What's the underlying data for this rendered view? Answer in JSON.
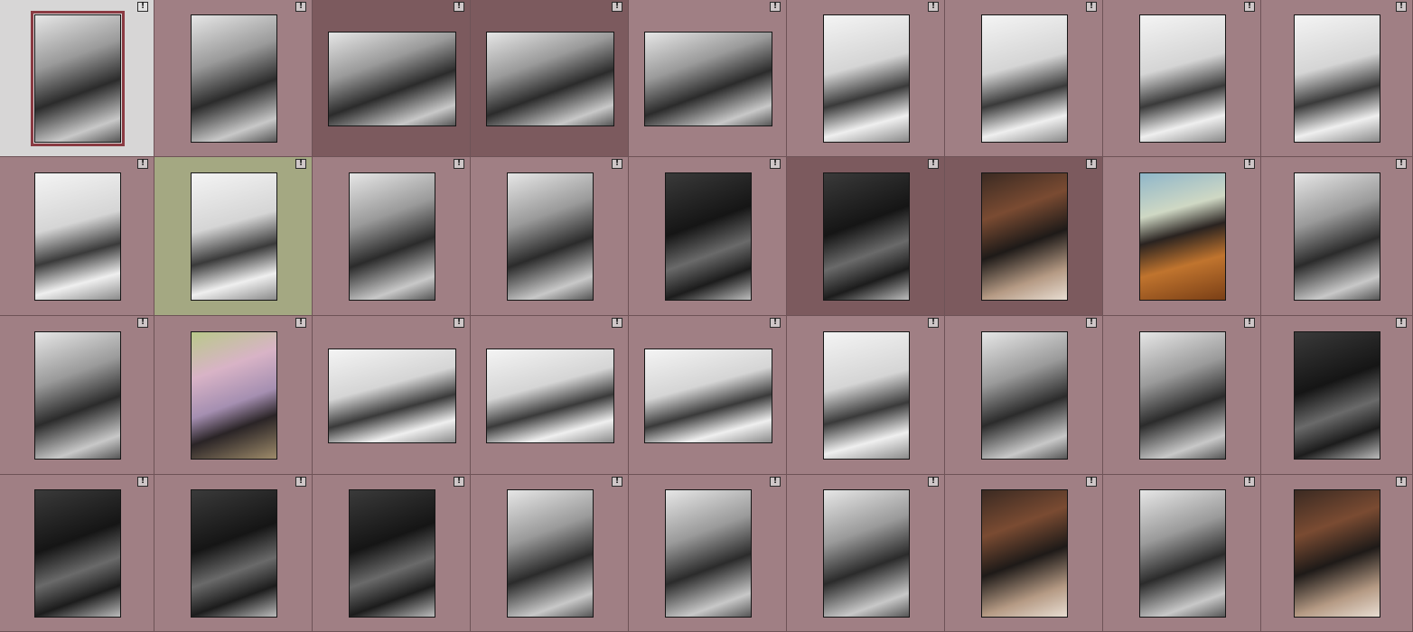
{
  "grid": {
    "badge": "!",
    "colors": {
      "cell": "#a07f84",
      "selected": "#7c5a5e",
      "active_cell": "#d7d6d6",
      "green_cell": "#a4a882"
    },
    "rows": [
      [
        {
          "shape": "portrait",
          "tone": "bw",
          "cell": "active"
        },
        {
          "shape": "portrait",
          "tone": "bw"
        },
        {
          "shape": "landscape",
          "tone": "bw",
          "cell": "selected"
        },
        {
          "shape": "landscape",
          "tone": "bw",
          "cell": "selected"
        },
        {
          "shape": "landscape",
          "tone": "bw"
        },
        {
          "shape": "portrait",
          "tone": "bw-light"
        },
        {
          "shape": "portrait",
          "tone": "bw-light"
        },
        {
          "shape": "portrait",
          "tone": "bw-light"
        },
        {
          "shape": "portrait",
          "tone": "bw-light"
        }
      ],
      [
        {
          "shape": "portrait",
          "tone": "bw-light"
        },
        {
          "shape": "portrait",
          "tone": "bw-light",
          "cell": "green"
        },
        {
          "shape": "portrait",
          "tone": "bw"
        },
        {
          "shape": "portrait",
          "tone": "bw"
        },
        {
          "shape": "portrait",
          "tone": "bw-dark"
        },
        {
          "shape": "portrait",
          "tone": "bw-dark",
          "cell": "selected"
        },
        {
          "shape": "portrait",
          "tone": "color-warm",
          "cell": "selected"
        },
        {
          "shape": "portrait",
          "tone": "color-fur"
        },
        {
          "shape": "portrait",
          "tone": "bw"
        }
      ],
      [
        {
          "shape": "portrait",
          "tone": "bw"
        },
        {
          "shape": "portrait",
          "tone": "color-pink"
        },
        {
          "shape": "landscape",
          "tone": "bw-light"
        },
        {
          "shape": "landscape",
          "tone": "bw-light"
        },
        {
          "shape": "landscape",
          "tone": "bw-light"
        },
        {
          "shape": "portrait",
          "tone": "bw-light"
        },
        {
          "shape": "portrait",
          "tone": "bw"
        },
        {
          "shape": "portrait",
          "tone": "bw"
        },
        {
          "shape": "portrait",
          "tone": "bw-dark"
        }
      ],
      [
        {
          "shape": "portrait",
          "tone": "bw-dark"
        },
        {
          "shape": "portrait",
          "tone": "bw-dark"
        },
        {
          "shape": "portrait",
          "tone": "bw-dark"
        },
        {
          "shape": "portrait",
          "tone": "bw"
        },
        {
          "shape": "portrait",
          "tone": "bw"
        },
        {
          "shape": "portrait",
          "tone": "bw"
        },
        {
          "shape": "portrait",
          "tone": "color-warm"
        },
        {
          "shape": "portrait",
          "tone": "bw"
        },
        {
          "shape": "portrait",
          "tone": "color-warm"
        }
      ]
    ]
  }
}
